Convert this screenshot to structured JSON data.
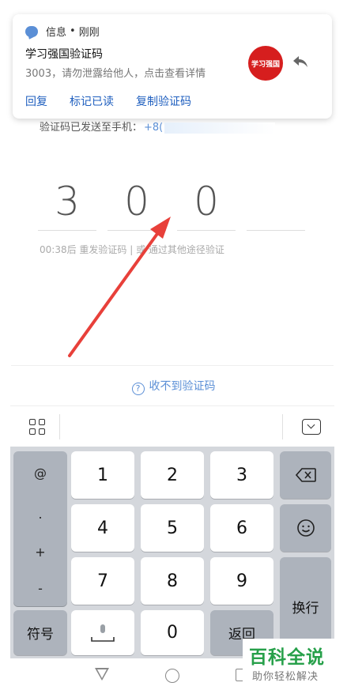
{
  "notification": {
    "app": "信息",
    "separator": "•",
    "time": "刚刚",
    "title": "学习强国验证码",
    "body": "3003，请勿泄露给他人，点击查看详情",
    "logo_text": "学习强国",
    "actions": [
      "回复",
      "标记已读",
      "复制验证码"
    ]
  },
  "sent_to": {
    "label": "验证码已发送至手机：",
    "phone_prefix": "+8("
  },
  "code_digits": [
    "3",
    "0",
    "0",
    ""
  ],
  "resend_hint": "00:38后 重发验证码 | 或 通过其他途径验证",
  "no_code_link": "收不到验证码",
  "keyboard": {
    "side_symbols": [
      "@",
      ".",
      "+",
      "-"
    ],
    "keys": [
      "1",
      "2",
      "3",
      "4",
      "5",
      "6",
      "7",
      "8",
      "9",
      "0"
    ],
    "symbol_key": "符号",
    "return_key": "返回",
    "newline_key": "换行"
  },
  "watermark": {
    "main": "百科全说",
    "sub": "助你轻松解决"
  },
  "colors": {
    "link_blue": "#1f5fbf",
    "accent_blue": "#5b8fd6",
    "arrow_red": "#e8403a",
    "logo_red": "#d61e1e",
    "watermark_green": "#27a04a"
  }
}
